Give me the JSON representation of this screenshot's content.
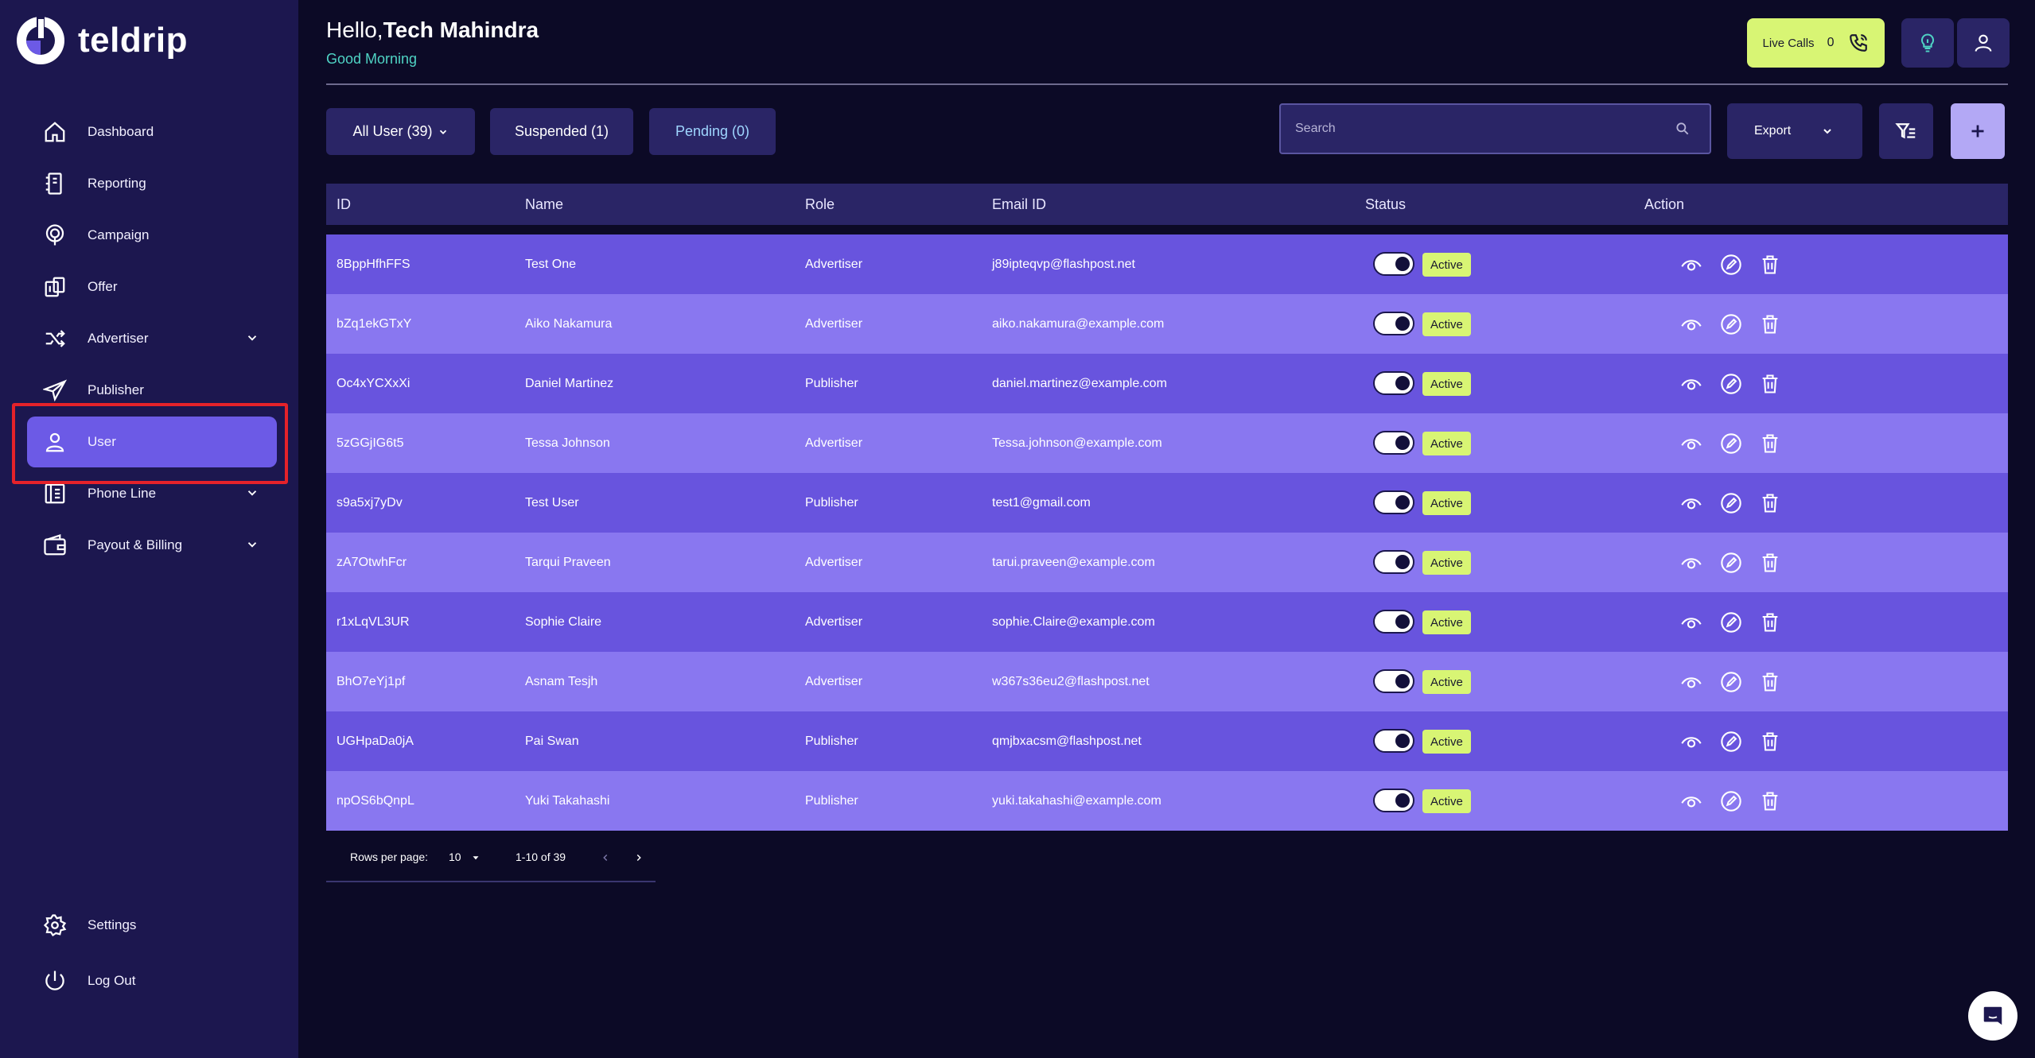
{
  "brand": {
    "name": "teldrip"
  },
  "header": {
    "greeting_prefix": "Hello,",
    "user_name": "Tech Mahindra",
    "subtitle": "Good Morning",
    "live_calls_label": "Live Calls",
    "live_calls_count": "0"
  },
  "sidebar": {
    "items": [
      {
        "label": "Dashboard",
        "icon": "home-icon"
      },
      {
        "label": "Reporting",
        "icon": "report-icon"
      },
      {
        "label": "Campaign",
        "icon": "campaign-icon"
      },
      {
        "label": "Offer",
        "icon": "offer-icon"
      },
      {
        "label": "Advertiser",
        "icon": "shuffle-icon"
      },
      {
        "label": "Publisher",
        "icon": "send-icon"
      },
      {
        "label": "User",
        "icon": "user-icon"
      },
      {
        "label": "Phone Line",
        "icon": "phone-line-icon"
      },
      {
        "label": "Payout & Billing",
        "icon": "wallet-icon"
      }
    ],
    "settings_label": "Settings",
    "logout_label": "Log Out",
    "active_item": "User"
  },
  "toolbar": {
    "all_user": "All User  (39)",
    "suspended": "Suspended (1)",
    "pending": "Pending (0)",
    "search_placeholder": "Search",
    "export_label": "Export"
  },
  "table": {
    "headers": [
      "ID",
      "Name",
      "Role",
      "Email ID",
      "Status",
      "Action"
    ],
    "rows": [
      {
        "id": "8BppHfhFFS",
        "name": "Test One",
        "role": "Advertiser",
        "email": "j89ipteqvp@flashpost.net",
        "status": "Active"
      },
      {
        "id": "bZq1ekGTxY",
        "name": "Aiko Nakamura",
        "role": "Advertiser",
        "email": "aiko.nakamura@example.com",
        "status": "Active"
      },
      {
        "id": "Oc4xYCXxXi",
        "name": "Daniel Martinez",
        "role": "Publisher",
        "email": "daniel.martinez@example.com",
        "status": "Active"
      },
      {
        "id": "5zGGjIG6t5",
        "name": "Tessa Johnson",
        "role": "Advertiser",
        "email": "Tessa.johnson@example.com",
        "status": "Active"
      },
      {
        "id": "s9a5xj7yDv",
        "name": "Test User",
        "role": "Publisher",
        "email": "test1@gmail.com",
        "status": "Active"
      },
      {
        "id": "zA7OtwhFcr",
        "name": "Tarqui Praveen",
        "role": "Advertiser",
        "email": "tarui.praveen@example.com",
        "status": "Active"
      },
      {
        "id": "r1xLqVL3UR",
        "name": "Sophie Claire",
        "role": "Advertiser",
        "email": "sophie.Claire@example.com",
        "status": "Active"
      },
      {
        "id": "BhO7eYj1pf",
        "name": "Asnam Tesjh",
        "role": "Advertiser",
        "email": "w367s36eu2@flashpost.net",
        "status": "Active"
      },
      {
        "id": "UGHpaDa0jA",
        "name": "Pai Swan",
        "role": "Publisher",
        "email": "qmjbxacsm@flashpost.net",
        "status": "Active"
      },
      {
        "id": "npOS6bQnpL",
        "name": "Yuki Takahashi",
        "role": "Publisher",
        "email": "yuki.takahashi@example.com",
        "status": "Active"
      }
    ]
  },
  "pagination": {
    "rows_per_page_label": "Rows per page:",
    "rows_per_page": "10",
    "range": "1-10 of 39"
  },
  "colors": {
    "accent": "#6c5ae6",
    "lime": "#d8f574",
    "sidebar_bg": "#1c174f",
    "page_bg": "#0c0a26"
  }
}
